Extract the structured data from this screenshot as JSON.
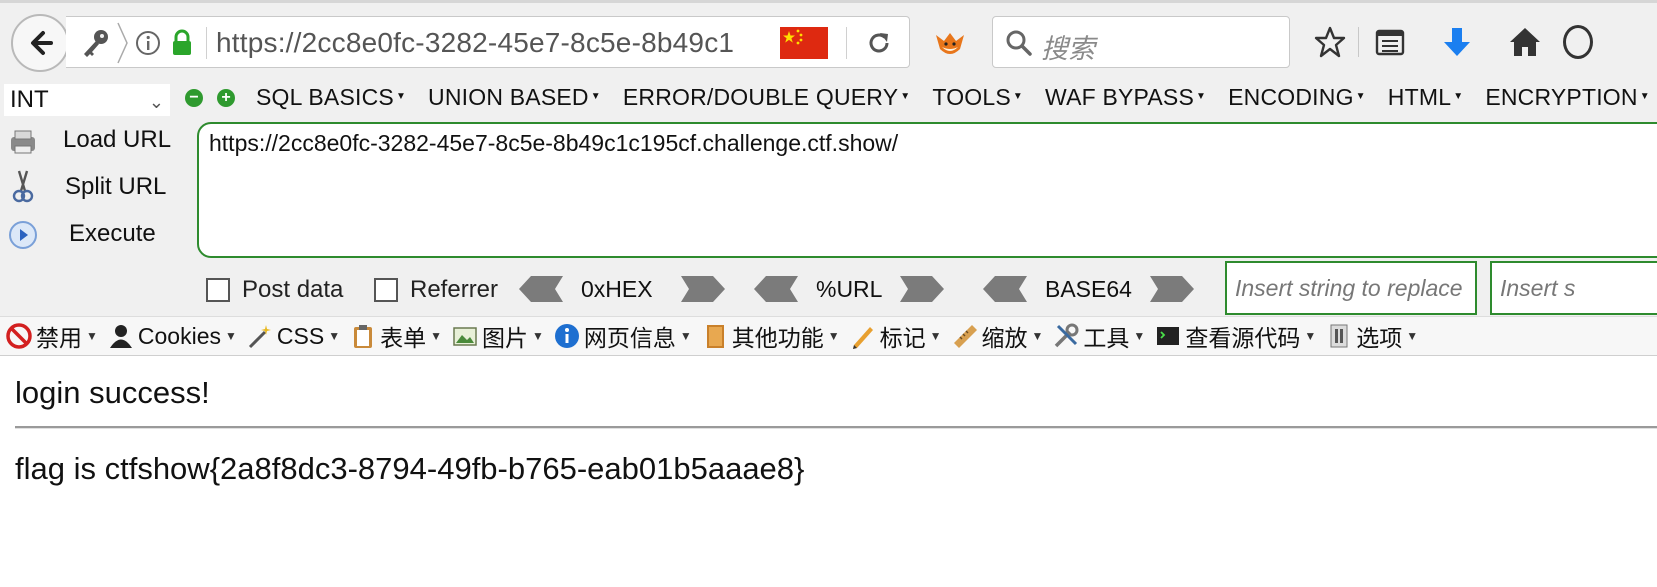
{
  "browser": {
    "url_display": "https://2cc8e0fc-3282-45e7-8c5e-8b49c1",
    "search_placeholder": "搜索",
    "icons": {
      "back": "arrow-left",
      "identity": "key-icon",
      "info": "info-icon",
      "lock": "lock-icon",
      "flag": "china-flag",
      "reload": "reload-icon",
      "addon": "fox-icon",
      "search": "magnifier",
      "bookmark": "star",
      "library": "reading-list",
      "download": "down-arrow",
      "home": "house"
    }
  },
  "hackbar": {
    "type_select": "INT",
    "menus": [
      "SQL BASICS",
      "UNION BASED",
      "ERROR/DOUBLE QUERY",
      "TOOLS",
      "WAF BYPASS",
      "ENCODING",
      "HTML",
      "ENCRYPTION"
    ],
    "load_url_label": "Load URL",
    "split_url_label": "Split URL",
    "execute_label": "Execute",
    "url_value": "https://2cc8e0fc-3282-45e7-8c5e-8b49c1c195cf.challenge.ctf.show/",
    "post_data_label": "Post data",
    "referrer_label": "Referrer",
    "hex_label": "0xHEX",
    "url_enc_label": "%URL",
    "base64_label": "BASE64",
    "replace_placeholder": "Insert string to replace",
    "replace_with_placeholder": "Insert s"
  },
  "devtoolbar": {
    "items": [
      "禁用",
      "Cookies",
      "CSS",
      "表单",
      "图片",
      "网页信息",
      "其他功能",
      "标记",
      "缩放",
      "工具",
      "查看源代码",
      "选项"
    ]
  },
  "page": {
    "line1": "login success!",
    "line2": "flag is ctfshow{2a8f8dc3-8794-49fb-b765-eab01b5aaae8}"
  },
  "colors": {
    "accent_green": "#2e8b2e",
    "lock_green": "#2aa52a",
    "download_blue": "#1b7ff0",
    "flag_red": "#de2910"
  }
}
